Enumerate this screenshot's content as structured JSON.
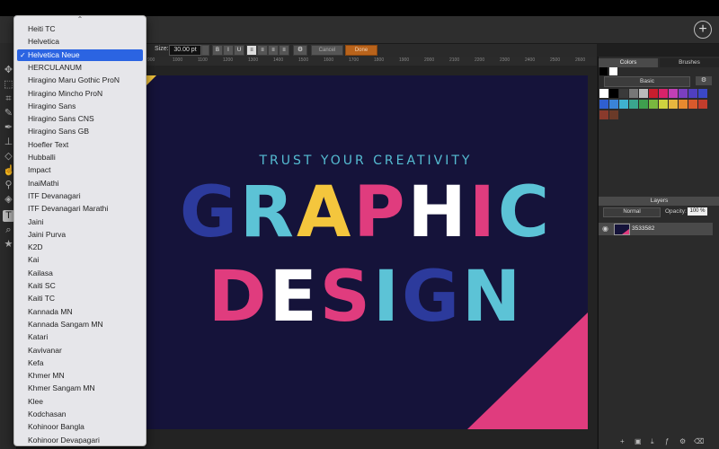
{
  "options_bar": {
    "size_label": "Size:",
    "size_value": "30.00 pt",
    "format_buttons": [
      "B",
      "I",
      "U"
    ],
    "align_buttons": [
      "≡",
      "≡",
      "≡",
      "≡"
    ],
    "cancel_label": "Cancel",
    "done_label": "Done"
  },
  "ruler": {
    "ticks": [
      "900",
      "1000",
      "1100",
      "1200",
      "1300",
      "1400",
      "1500",
      "1600",
      "1700",
      "1800",
      "1900",
      "2000",
      "2100",
      "2200",
      "2300",
      "2400",
      "2500",
      "2600",
      "2700"
    ]
  },
  "artboard": {
    "tagline": "TRUST YOUR CREATIVITY",
    "headline1": "GRAPHIC",
    "headline2": "DESIGN",
    "colors": {
      "background": "#15133a",
      "blue": "#2c3a9c",
      "cyan": "#5cc3d6",
      "yellow": "#f4c63d",
      "pink": "#e03c7e",
      "white": "#ffffff"
    }
  },
  "right_panel": {
    "tabs": [
      "Colors",
      "Brushes"
    ],
    "active_tab": "Colors",
    "preset": "Basic",
    "swatch_colors": [
      "#ffffff",
      "#000000",
      "#3a3a3a",
      "#777777",
      "#bbbbbb",
      "#c81e2e",
      "#d8226a",
      "#c13fb5",
      "#7b3fc1",
      "#503fbf",
      "#3b48c7",
      "#2f5fd1",
      "#3a84d8",
      "#3fb2cf",
      "#3aa68e",
      "#3f9f4e",
      "#79b83f",
      "#cfd23f",
      "#e8b73f",
      "#e88a2f",
      "#d95a2c",
      "#c23d2c",
      "#8a3a2c",
      "#6a3a28"
    ],
    "layers_title": "Layers",
    "blend_mode": "Normal",
    "opacity_label": "Opacity:",
    "opacity_value": "100 %",
    "layer_name": "3533582"
  },
  "tools": [
    "move-icon",
    "marquee-icon",
    "crop-icon",
    "brush-icon",
    "pen-icon",
    "stamp-icon",
    "eraser-icon",
    "smudge-icon",
    "dropper-icon",
    "fill-icon",
    "text-icon",
    "zoom-icon",
    "star-icon"
  ],
  "font_menu": {
    "fonts": [
      "Heiti TC",
      "Helvetica",
      "Helvetica Neue",
      "HERCULANUM",
      "Hiragino Maru Gothic ProN",
      "Hiragino Mincho ProN",
      "Hiragino Sans",
      "Hiragino Sans CNS",
      "Hiragino Sans GB",
      "Hoefler Text",
      "Hubballi",
      "Impact",
      "InaiMathi",
      "ITF Devanagari",
      "ITF Devanagari Marathi",
      "Jaini",
      "Jaini Purva",
      "K2D",
      "Kai",
      "Kailasa",
      "Kaiti SC",
      "Kaiti TC",
      "Kannada MN",
      "Kannada Sangam MN",
      "Katari",
      "Kavivanar",
      "Kefa",
      "Khmer MN",
      "Khmer Sangam MN",
      "Klee",
      "Kodchasan",
      "Kohinoor Bangla",
      "Kohinoor Devanagari"
    ],
    "selected": "Helvetica Neue",
    "checkmark": "✓",
    "scroll_up": "⌃",
    "scroll_down": "⌄"
  }
}
